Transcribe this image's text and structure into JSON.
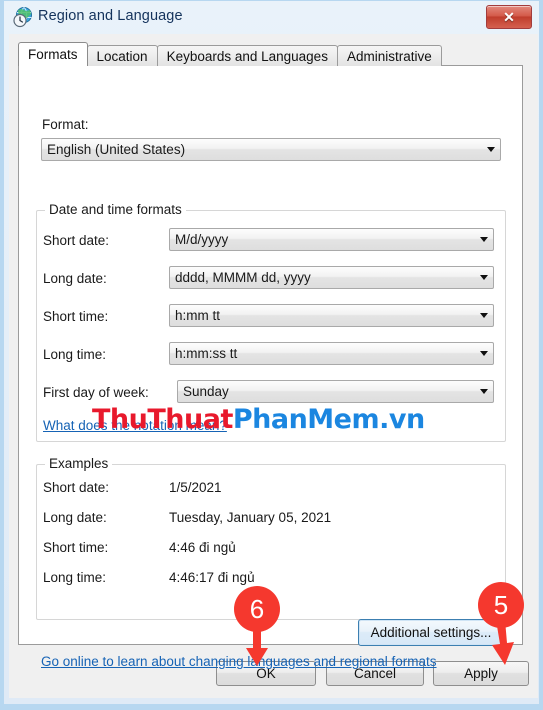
{
  "window": {
    "title": "Region and Language",
    "icon": "region-globe-clock-icon",
    "close_label": "✕"
  },
  "tabs": [
    {
      "label": "Formats",
      "active": true
    },
    {
      "label": "Location",
      "active": false
    },
    {
      "label": "Keyboards and Languages",
      "active": false
    },
    {
      "label": "Administrative",
      "active": false
    }
  ],
  "format_section": {
    "label": "Format:",
    "value": "English (United States)"
  },
  "datetime_group": {
    "caption": "Date and time formats",
    "rows": [
      {
        "label": "Short date:",
        "value": "M/d/yyyy"
      },
      {
        "label": "Long date:",
        "value": "dddd, MMMM dd, yyyy"
      },
      {
        "label": "Short time:",
        "value": "h:mm tt"
      },
      {
        "label": "Long time:",
        "value": "h:mm:ss tt"
      },
      {
        "label": "First day of week:",
        "value": "Sunday"
      }
    ],
    "notation_link": "What does the notation mean?"
  },
  "examples_group": {
    "caption": "Examples",
    "rows": [
      {
        "label": "Short date:",
        "value": "1/5/2021"
      },
      {
        "label": "Long date:",
        "value": "Tuesday, January 05, 2021"
      },
      {
        "label": "Short time:",
        "value": "4:46 đi ngủ"
      },
      {
        "label": "Long time:",
        "value": "4:46:17 đi ngủ"
      }
    ]
  },
  "additional_settings_button": "Additional settings...",
  "online_link": "Go online to learn about changing languages and regional formats",
  "buttons": {
    "ok": "OK",
    "cancel": "Cancel",
    "apply": "Apply"
  },
  "watermark": {
    "red_part": "ThuThuat",
    "blue_part": "PhanMem.vn"
  },
  "annotations": [
    {
      "number": "6",
      "target": "ok-button"
    },
    {
      "number": "5",
      "target": "apply-button"
    }
  ],
  "colors": {
    "accent_red": "#f5382e",
    "link_blue": "#1663b5",
    "watermark_red": "#e8192c",
    "watermark_blue": "#1b86e0",
    "close_red": "#c03d2c"
  }
}
